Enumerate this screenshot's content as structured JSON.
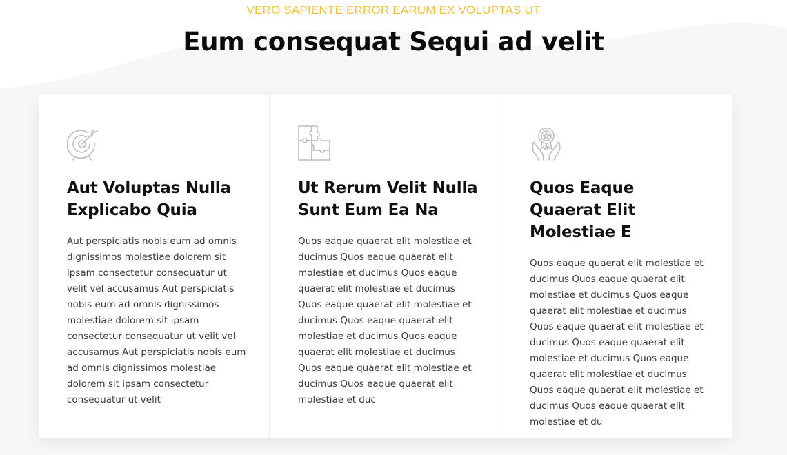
{
  "section": {
    "kicker": "VERO SAPIENTE ERROR EARUM EX VOLUPTAS UT",
    "title": "Eum consequat Sequi ad velit"
  },
  "colors": {
    "accent": "#f5c13b",
    "icon": "#bdbdbd",
    "heading": "#111111",
    "body_text": "#3a3a3a"
  },
  "cards": [
    {
      "icon": "target-icon",
      "title": "Aut Voluptas Nulla Explicabo Quia",
      "text": "Aut perspiciatis nobis eum ad omnis dignissimos molestiae dolorem sit ipsam consectetur consequatur ut velit vel accusamus Aut perspiciatis nobis eum ad omnis dignissimos molestiae dolorem sit ipsam consectetur consequatur ut velit vel accusamus Aut perspiciatis nobis eum ad omnis dignissimos molestiae dolorem sit ipsam consectetur consequatur ut velit"
    },
    {
      "icon": "puzzle-icon",
      "title": "Ut Rerum Velit Nulla Sunt Eum Ea Na",
      "text": "Quos eaque quaerat elit molestiae et ducimus Quos eaque quaerat elit molestiae et ducimus Quos eaque quaerat elit molestiae et ducimus Quos eaque quaerat elit molestiae et ducimus Quos eaque quaerat elit molestiae et ducimus Quos eaque quaerat elit molestiae et ducimus Quos eaque quaerat elit molestiae et ducimus Quos eaque quaerat elit molestiae et duc"
    },
    {
      "icon": "award-hands-icon",
      "title": "Quos Eaque Quaerat Elit Molestiae E",
      "text": "Quos eaque quaerat elit molestiae et ducimus Quos eaque quaerat elit molestiae et ducimus Quos eaque quaerat elit molestiae et ducimus Quos eaque quaerat elit molestiae et ducimus Quos eaque quaerat elit molestiae et ducimus Quos eaque quaerat elit molestiae et ducimus Quos eaque quaerat elit molestiae et ducimus Quos eaque quaerat elit molestiae et du"
    }
  ]
}
